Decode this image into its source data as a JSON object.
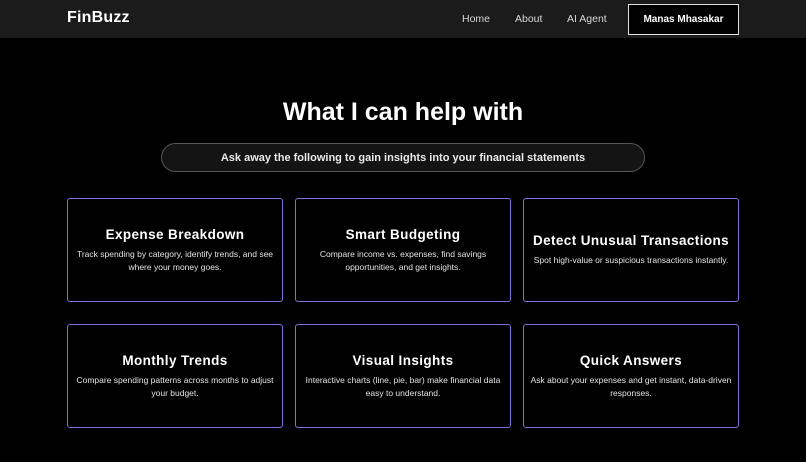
{
  "nav": {
    "logo": "FinBuzz",
    "links": [
      "Home",
      "About",
      "AI Agent"
    ],
    "user_button": "Manas Mhasakar"
  },
  "hero": {
    "title": "What I can help with",
    "subtitle": "Ask away the following to gain insights into your financial statements"
  },
  "cards": [
    {
      "title": "Expense Breakdown",
      "desc": "Track spending by category, identify trends, and see where your money goes."
    },
    {
      "title": "Smart Budgeting",
      "desc": "Compare income vs. expenses, find savings opportunities, and get insights."
    },
    {
      "title": "Detect Unusual Transactions",
      "desc": "Spot high-value or suspicious transactions instantly."
    },
    {
      "title": "Monthly Trends",
      "desc": "Compare spending patterns across months to adjust your budget."
    },
    {
      "title": "Visual Insights",
      "desc": "Interactive charts (line, pie, bar) make financial data easy to understand."
    },
    {
      "title": "Quick Answers",
      "desc": "Ask about your expenses and get instant, data-driven responses."
    }
  ],
  "colors": {
    "navbar_bg": "#1b1b1b",
    "page_bg": "#000000",
    "card_border": "#7c72d9"
  }
}
